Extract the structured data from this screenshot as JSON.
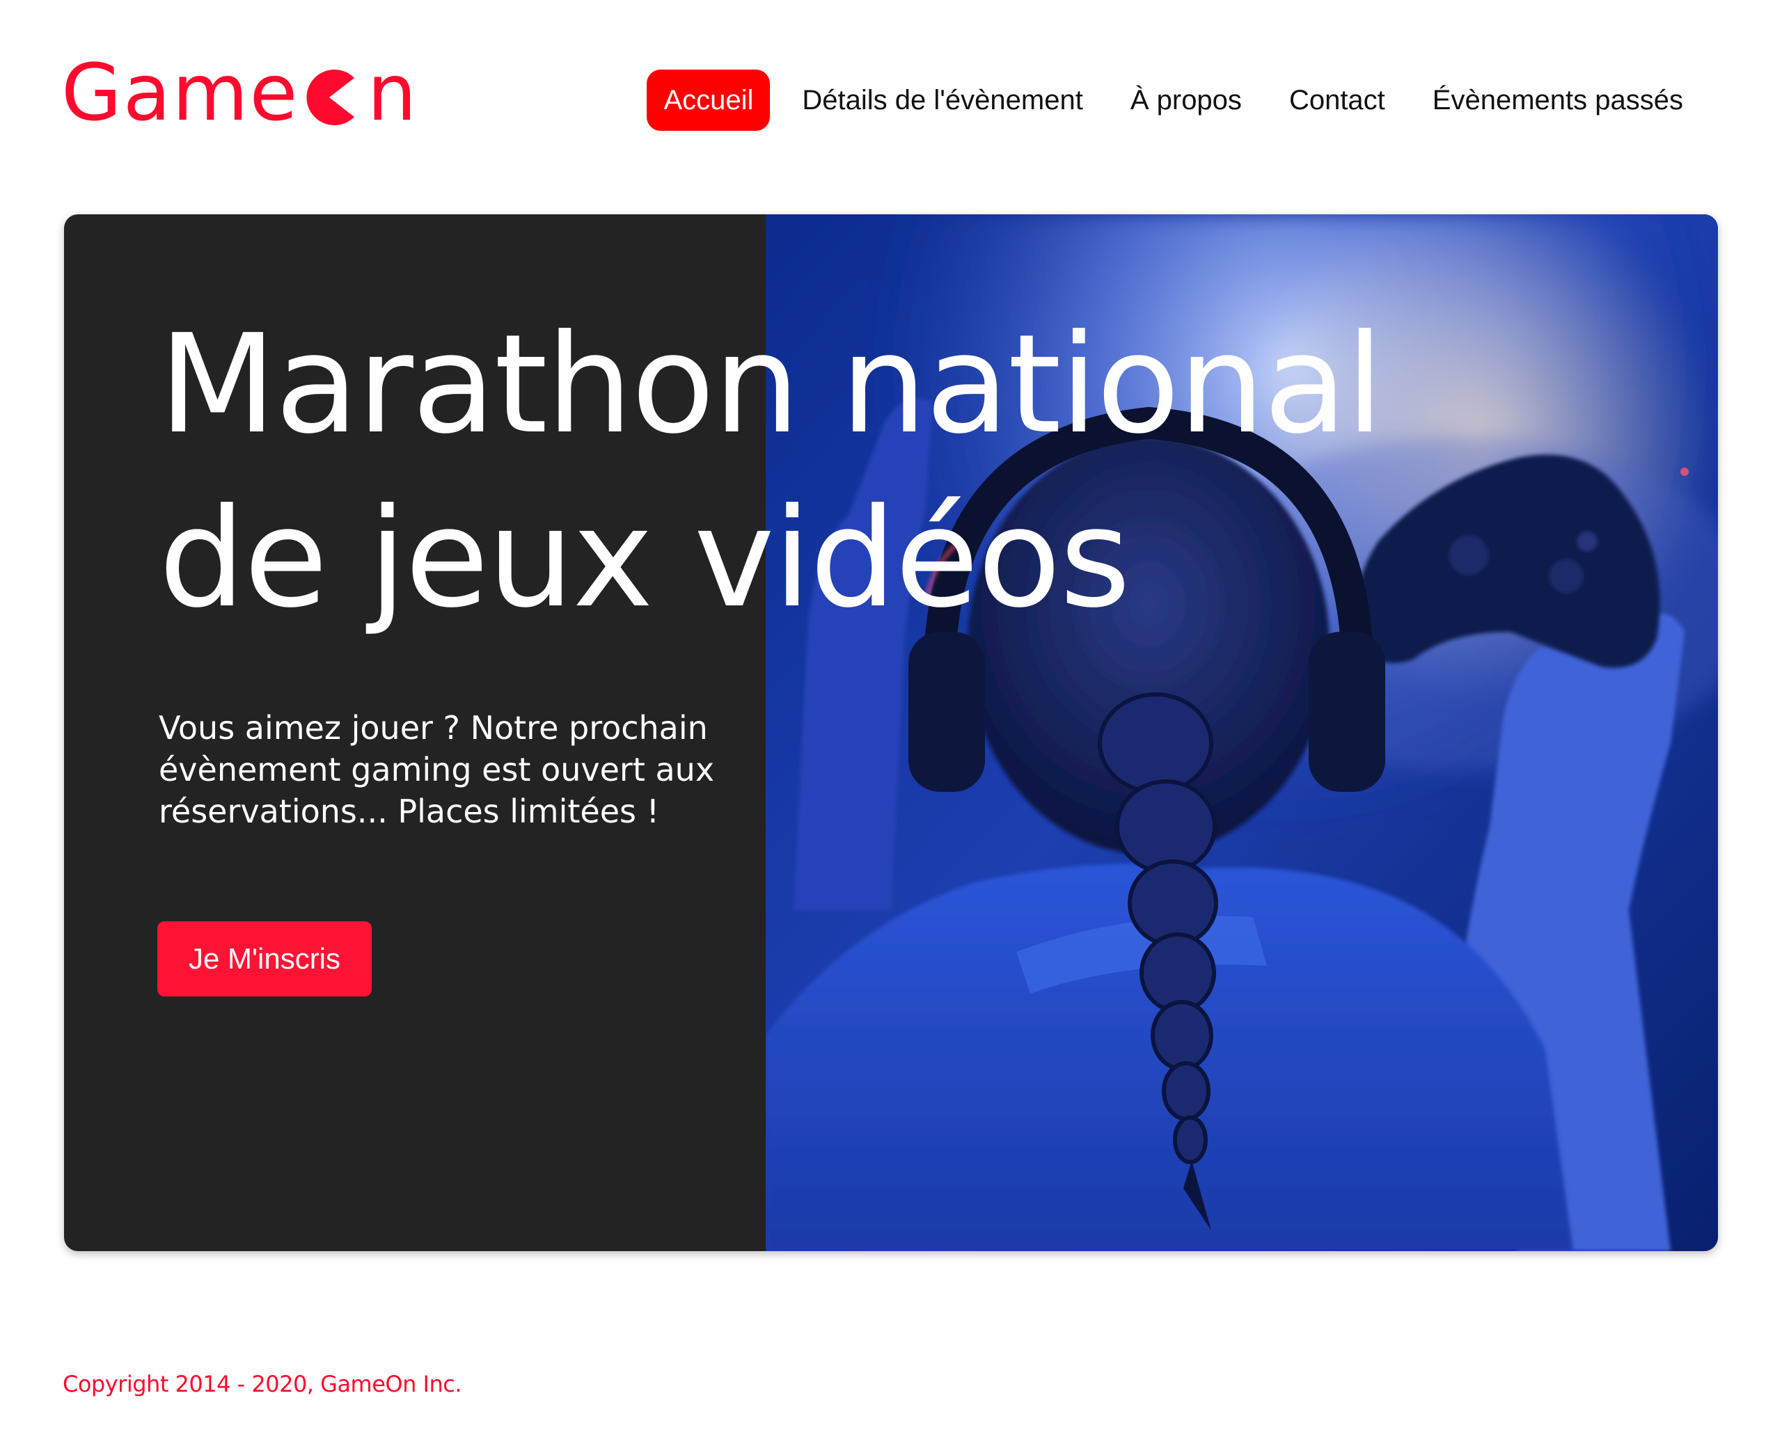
{
  "brand": {
    "name_prefix": "Game",
    "name_suffix": "n",
    "color": "#ff0a2e"
  },
  "nav": {
    "items": [
      {
        "label": "Accueil",
        "active": true
      },
      {
        "label": "Détails de l'évènement",
        "active": false
      },
      {
        "label": "À propos",
        "active": false
      },
      {
        "label": "Contact",
        "active": false
      },
      {
        "label": "Évènements passés",
        "active": false
      }
    ],
    "active_color": "#ff0000"
  },
  "hero": {
    "title_line1": "Marathon national",
    "title_line2": "de jeux vidéos",
    "text": "Vous aimez jouer ? Notre prochain évènement gaming est ouvert aux réservations... Places limitées !",
    "cta_label": "Je M'inscris",
    "cta_color": "#ff1335",
    "panel_color": "#232323",
    "image_subject": "gamer with headphones and braid raising a game controller in blue light"
  },
  "footer": {
    "copyright": "Copyright 2014 - 2020, GameOn Inc."
  }
}
